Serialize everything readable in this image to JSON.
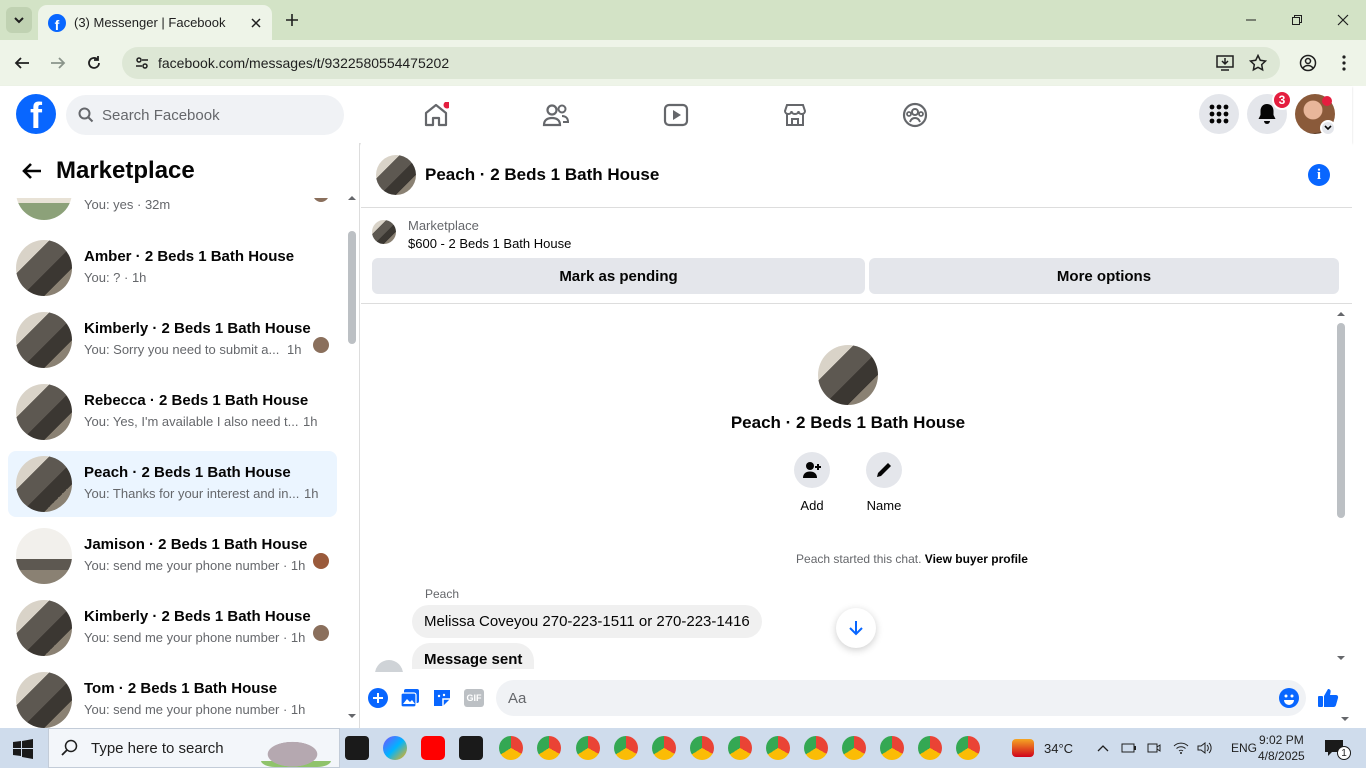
{
  "browser": {
    "tab_title": "(3) Messenger | Facebook",
    "url": "facebook.com/messages/t/9322580554475202"
  },
  "fb_header": {
    "search_placeholder": "Search Facebook",
    "notification_count": "3"
  },
  "sidebar": {
    "title": "Marketplace",
    "conversations": [
      {
        "name": "",
        "snippet": "You: yes · 32m",
        "time": ""
      },
      {
        "name": "Amber · 2 Beds 1 Bath House",
        "snippet": "You: ? · 1h",
        "time": ""
      },
      {
        "name": "Kimberly · 2 Beds 1 Bath House",
        "snippet": "You: Sorry you need to submit a...",
        "time": "1h"
      },
      {
        "name": "Rebecca · 2 Beds 1 Bath House",
        "snippet": "You: Yes, I'm available I also need t...",
        "time": "1h"
      },
      {
        "name": "Peach · 2 Beds 1 Bath House",
        "snippet": "You: Thanks for your interest and in...",
        "time": "1h"
      },
      {
        "name": "Jamison · 2 Beds 1 Bath House",
        "snippet": "You: send me your phone number · 1h",
        "time": ""
      },
      {
        "name": "Kimberly · 2 Beds 1 Bath House",
        "snippet": "You: send me your phone number · 1h",
        "time": ""
      },
      {
        "name": "Tom · 2 Beds 1 Bath House",
        "snippet": "You: send me your phone number · 1h",
        "time": ""
      }
    ]
  },
  "chat": {
    "title": "Peach · 2 Beds 1 Bath House",
    "marketplace_label": "Marketplace",
    "listing": "$600 - 2 Beds 1 Bath House",
    "mark_pending": "Mark as pending",
    "more_options": "More options",
    "intro_title": "Peach · 2 Beds 1 Bath House",
    "add_label": "Add",
    "name_label": "Name",
    "started_text": "Peach started this chat.",
    "view_buyer": "View buyer profile",
    "sender": "Peach",
    "message1": "Melissa Coveyou 270-223-1511 or 270-223-1416",
    "message2": "Message sent",
    "composer_placeholder": "Aa",
    "gif_label": "GIF"
  },
  "taskbar": {
    "search_placeholder": "Type here to search",
    "weather": "34°C",
    "language": "ENG",
    "time": "9:02 PM",
    "date": "4/8/2025",
    "notif_count": "1"
  },
  "colors": {
    "fb_blue": "#0866ff",
    "active_conv": "#ebf5ff",
    "badge_red": "#e41e3f"
  }
}
